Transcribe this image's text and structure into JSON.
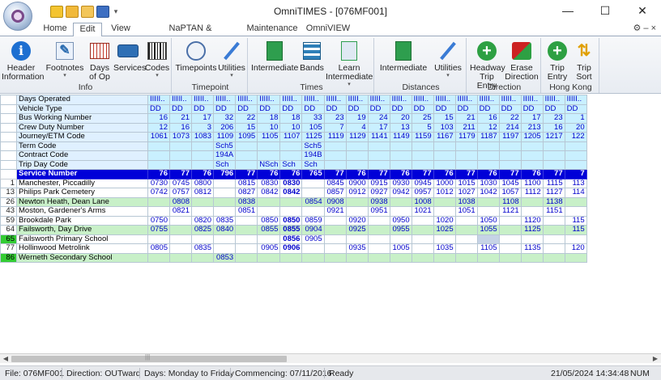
{
  "window": {
    "title": "OmniTIMES - [076MF001]",
    "minimize": "—",
    "maximize": "☐",
    "close": "✕"
  },
  "tabs": [
    "Home",
    "Edit",
    "View",
    "NaPTAN & TransXChange",
    "Maintenance",
    "OmniVIEW"
  ],
  "active_tab": "Edit",
  "ribbon_right": "⚙ – ×",
  "ribbon": {
    "groups": [
      {
        "label": "Info",
        "buttons": [
          {
            "label": "Header Information",
            "icon": "info-icon",
            "color": "#1d6fd1"
          },
          {
            "label": "Footnotes",
            "icon": "pencil-icon",
            "color": "#2b6cb0"
          },
          {
            "label": "Days of Op",
            "icon": "calendar-icon",
            "color": "#c0392b"
          },
          {
            "label": "Services",
            "icon": "bus-icon",
            "color": "#2e6fb5"
          },
          {
            "label": "Codes",
            "icon": "barcode-icon",
            "color": "#333333"
          }
        ]
      },
      {
        "label": "Timepoint",
        "buttons": [
          {
            "label": "Timepoints",
            "icon": "clock-icon",
            "color": "#4a6fa8"
          },
          {
            "label": "Utilities",
            "icon": "screwdriver-icon",
            "color": "#3a7bd5"
          }
        ]
      },
      {
        "label": "Times",
        "buttons": [
          {
            "label": "Intermediate",
            "icon": "intermediate-icon",
            "color": "#2e9e4e"
          },
          {
            "label": "Bands",
            "icon": "bands-icon",
            "color": "#2e7fb8"
          },
          {
            "label": "Learn Intermediate",
            "icon": "learn-icon",
            "color": "#2e9e4e"
          }
        ]
      },
      {
        "label": "Distances",
        "buttons": [
          {
            "label": "Intermediate",
            "icon": "distance-icon",
            "color": "#2e9e4e"
          },
          {
            "label": "Utilities",
            "icon": "screwdriver-icon",
            "color": "#3a7bd5"
          }
        ]
      },
      {
        "label": "Direction",
        "buttons": [
          {
            "label": "Headway Trip Entry",
            "icon": "plus-circle-icon",
            "color": "#2ea043"
          },
          {
            "label": "Erase Direction",
            "icon": "erase-icon",
            "color": "#cc2222"
          }
        ]
      },
      {
        "label": "Hong Kong",
        "buttons": [
          {
            "label": "Trip Entry",
            "icon": "plus-circle-icon",
            "color": "#2ea043"
          },
          {
            "label": "Trip Sort",
            "icon": "sort-icon",
            "color": "#e0a000"
          }
        ]
      }
    ]
  },
  "grid": {
    "header_rows": [
      {
        "label": "Days Operated",
        "values": [
          "IIIII..",
          "IIIII..",
          "IIIII..",
          "IIIII..",
          "IIIII..",
          "IIIII..",
          "IIIII..",
          "IIIII..",
          "IIIII..",
          "IIIII..",
          "IIIII..",
          "IIIII..",
          "IIIII..",
          "IIIII..",
          "IIIII..",
          "IIIII..",
          "IIIII..",
          "IIIII..",
          "IIIII..",
          "IIIII.."
        ],
        "align": "l"
      },
      {
        "label": "Vehicle Type",
        "values": [
          "DD",
          "DD",
          "DD",
          "DD",
          "DD",
          "DD",
          "DD",
          "DD",
          "DD",
          "DD",
          "DD",
          "DD",
          "DD",
          "DD",
          "DD",
          "DD",
          "DD",
          "DD",
          "DD",
          "DD"
        ],
        "align": "l"
      },
      {
        "label": "Bus Working Number",
        "values": [
          "16",
          "21",
          "17",
          "32",
          "22",
          "18",
          "18",
          "33",
          "23",
          "19",
          "24",
          "20",
          "25",
          "15",
          "21",
          "16",
          "22",
          "17",
          "23",
          "1"
        ]
      },
      {
        "label": "Crew Duty Number",
        "values": [
          "12",
          "16",
          "3",
          "206",
          "15",
          "10",
          "10",
          "105",
          "7",
          "4",
          "17",
          "13",
          "5",
          "103",
          "211",
          "12",
          "214",
          "213",
          "16",
          "20"
        ]
      },
      {
        "label": "Journey/ETM Code",
        "values": [
          "1061",
          "1073",
          "1083",
          "1109",
          "1095",
          "1105",
          "1107",
          "1125",
          "1119",
          "1129",
          "1141",
          "1149",
          "1159",
          "1167",
          "1179",
          "1187",
          "1197",
          "1205",
          "1217",
          "122"
        ]
      },
      {
        "label": "Term Code",
        "values": [
          "",
          "",
          "",
          "Sch5",
          "",
          "",
          "",
          "Sch5",
          "",
          "",
          "",
          "",
          "",
          "",
          "",
          "",
          "",
          "",
          "",
          ""
        ],
        "align": "l"
      },
      {
        "label": "Contract Code",
        "values": [
          "",
          "",
          "",
          "194A",
          "",
          "",
          "",
          "194B",
          "",
          "",
          "",
          "",
          "",
          "",
          "",
          "",
          "",
          "",
          "",
          ""
        ],
        "align": "l"
      },
      {
        "label": "Trip Day Code",
        "values": [
          "",
          "",
          "",
          "Sch",
          "",
          "NSch",
          "Sch",
          "Sch",
          "",
          "",
          "",
          "",
          "",
          "",
          "",
          "",
          "",
          "",
          "",
          ""
        ],
        "align": "l"
      }
    ],
    "service_row": {
      "label": "Service Number",
      "values": [
        "76",
        "77",
        "76",
        "796",
        "77",
        "76",
        "76",
        "765",
        "77",
        "76",
        "77",
        "76",
        "77",
        "76",
        "77",
        "76",
        "77",
        "76",
        "77",
        "7"
      ]
    },
    "stops": [
      {
        "num": "1",
        "name": "Manchester, Piccadilly",
        "bg": "w",
        "values": [
          "0730",
          "0745",
          "0800",
          "",
          "0815",
          "0830",
          "0830",
          "",
          "0845",
          "0900",
          "0915",
          "0930",
          "0945",
          "1000",
          "1015",
          "1030",
          "1045",
          "1100",
          "1115",
          "113"
        ],
        "bold": [
          6
        ]
      },
      {
        "num": "13",
        "name": "Philips Park Cemetery",
        "bg": "w",
        "values": [
          "0742",
          "0757",
          "0812",
          "",
          "0827",
          "0842",
          "0842",
          "",
          "0857",
          "0912",
          "0927",
          "0942",
          "0957",
          "1012",
          "1027",
          "1042",
          "1057",
          "1112",
          "1127",
          "114"
        ],
        "bold": [
          6
        ]
      },
      {
        "num": "26",
        "name": "Newton Heath, Dean Lane",
        "bg": "g",
        "values": [
          "",
          "0808",
          "",
          "",
          "0838",
          "",
          "",
          "0854",
          "0908",
          "",
          "0938",
          "",
          "1008",
          "",
          "1038",
          "",
          "1108",
          "",
          "1138",
          ""
        ],
        "bold": []
      },
      {
        "num": "43",
        "name": "Moston, Gardener's Arms",
        "bg": "w",
        "values": [
          "",
          "0821",
          "",
          "",
          "0851",
          "",
          "",
          "",
          "0921",
          "",
          "0951",
          "",
          "1021",
          "",
          "1051",
          "",
          "1121",
          "",
          "1151",
          ""
        ],
        "bold": []
      },
      {
        "num": "59",
        "name": "Brookdale Park",
        "bg": "w",
        "values": [
          "0750",
          "",
          "0820",
          "0835",
          "",
          "0850",
          "0850",
          "0859",
          "",
          "0920",
          "",
          "0950",
          "",
          "1020",
          "",
          "1050",
          "",
          "1120",
          "",
          "115"
        ],
        "bold": [
          6
        ]
      },
      {
        "num": "64",
        "name": "Failsworth, Day Drive",
        "bg": "g",
        "values": [
          "0755",
          "",
          "0825",
          "0840",
          "",
          "0855",
          "0855",
          "0904",
          "",
          "0925",
          "",
          "0955",
          "",
          "1025",
          "",
          "1055",
          "",
          "1125",
          "",
          "115"
        ],
        "bold": [
          6
        ]
      },
      {
        "num": "65",
        "name": "Failsworth Primary School",
        "bg": "w",
        "values": [
          "",
          "",
          "",
          "",
          "",
          "",
          "0856",
          "0905",
          "",
          "",
          "",
          "",
          "",
          "",
          "",
          "",
          "",
          "",
          "",
          ""
        ],
        "bold": [
          6
        ],
        "hl": true,
        "sel": [
          15
        ]
      },
      {
        "num": "77",
        "name": "Hollinwood Metrolink",
        "bg": "w",
        "values": [
          "0805",
          "",
          "0835",
          "",
          "",
          "0905",
          "0906",
          "",
          "",
          "0935",
          "",
          "1005",
          "",
          "1035",
          "",
          "1105",
          "",
          "1135",
          "",
          "120"
        ],
        "bold": [
          6
        ]
      },
      {
        "num": "86",
        "name": "Werneth Secondary School",
        "bg": "g",
        "values": [
          "",
          "",
          "",
          "0853",
          "",
          "",
          "",
          "",
          "",
          "",
          "",
          "",
          "",
          "",
          "",
          "",
          "",
          "",
          "",
          ""
        ],
        "bold": [],
        "hl": true
      }
    ]
  },
  "scrollbar": {
    "left": "◀",
    "right": "▶",
    "grip": "|||"
  },
  "status": {
    "file": "File: 076MF001",
    "direction": "Direction: OUTward",
    "days": "Days: Monday to Friday",
    "commencing": "Commencing: 07/11/2016",
    "ready": "Ready",
    "datetime": "21/05/2024 14:34:48",
    "num": "NUM"
  },
  "colors": {
    "service_row": "#0000d8",
    "header_cells": "#c9f0ff",
    "highlight_green": "#33cc33",
    "stop_green": "#c8f0c8",
    "time_text": "#0000cc"
  }
}
